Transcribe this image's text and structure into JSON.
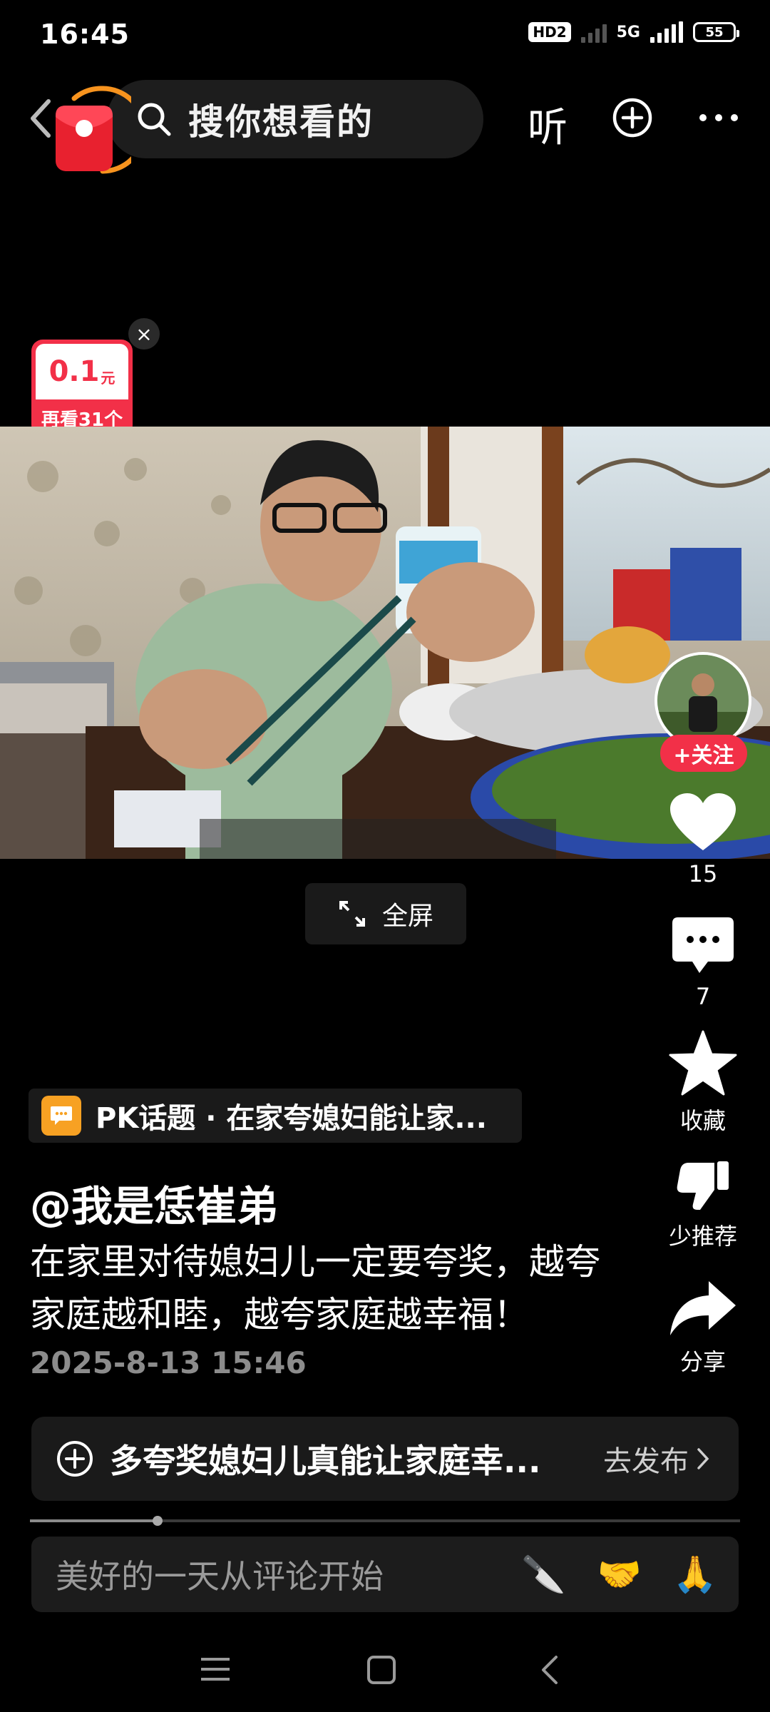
{
  "status_bar": {
    "time": "16:45",
    "network_badge": "HD2",
    "network_type": "5G",
    "battery": "55"
  },
  "top_bar": {
    "search_placeholder": "搜你想看的",
    "listen_label": "听"
  },
  "reward": {
    "amount": "0.1",
    "unit": "元",
    "hint": "再看31个",
    "close": "×"
  },
  "video": {
    "fullscreen_label": "全屏"
  },
  "actions": {
    "follow_label": "+关注",
    "like_count": "15",
    "comment_count": "7",
    "favorite_label": "收藏",
    "less_label": "少推荐",
    "share_label": "分享"
  },
  "post": {
    "pk_topic": "PK话题 · 在家夸媳妇能让家...",
    "author": "@我是恁崔弟",
    "description": "在家里对待媳妇儿一定要夸奖，越夸家庭越和睦，越夸家庭越幸福！",
    "date": "2025-8-13 15:46"
  },
  "publish": {
    "text": "多夸奖媳妇儿真能让家庭幸...",
    "action": "去发布"
  },
  "progress": {
    "fraction": 0.18
  },
  "comment": {
    "placeholder": "美好的一天从评论开始",
    "emojis": [
      "🔪",
      "🤝",
      "🙏"
    ]
  },
  "colors": {
    "accent": "#f23048",
    "pk_icon": "#f7a123"
  }
}
